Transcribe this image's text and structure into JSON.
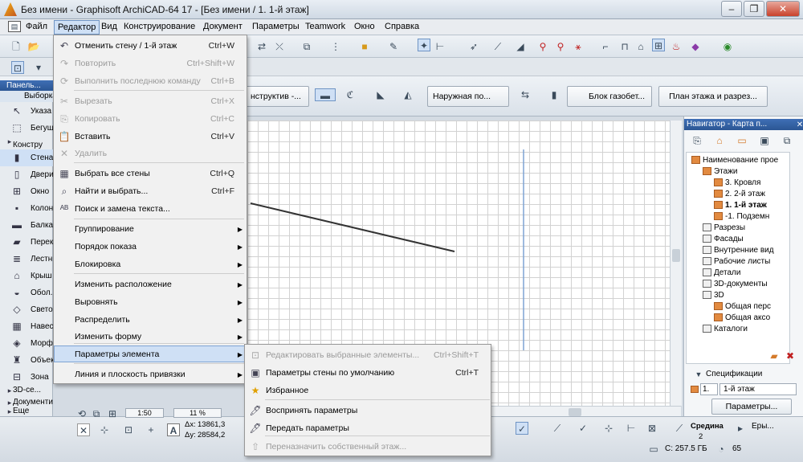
{
  "title": "Без имени - Graphisoft ArchiCAD-64 17 - [Без имени / 1. 1-й этаж]",
  "window_controls": {
    "minimize": "–",
    "maximize": "❐",
    "close": "✕"
  },
  "menu": [
    "Файл",
    "Редактор",
    "Вид",
    "Конструирование",
    "Документ",
    "Параметры",
    "Teamwork",
    "Окно",
    "Справка"
  ],
  "toolbar2": {
    "construct_label": "нструктив -...",
    "surface_label": "Наружная по...",
    "material_label": "Блок газобет...",
    "view_button": "План этажа и разрез..."
  },
  "left_panel": {
    "header": "Панель...",
    "select_tab": "Выборка",
    "items": [
      {
        "label": "Указа",
        "icon": "arrow-icon"
      },
      {
        "label": "Бегущ",
        "icon": "marquee-icon"
      },
      {
        "label": "Констру",
        "icon": "group-icon"
      },
      {
        "label": "Стена",
        "icon": "wall-icon"
      },
      {
        "label": "Двери",
        "icon": "door-icon"
      },
      {
        "label": "Окно",
        "icon": "window-icon"
      },
      {
        "label": "Колон",
        "icon": "column-icon"
      },
      {
        "label": "Балка",
        "icon": "beam-icon"
      },
      {
        "label": "Перек",
        "icon": "slab-icon"
      },
      {
        "label": "Лестн",
        "icon": "stair-icon"
      },
      {
        "label": "Крыш",
        "icon": "roof-icon"
      },
      {
        "label": "Обол.",
        "icon": "shell-icon"
      },
      {
        "label": "Свето",
        "icon": "skylight-icon"
      },
      {
        "label": "Навес",
        "icon": "curtain-wall-icon"
      },
      {
        "label": "Морф",
        "icon": "morph-icon"
      },
      {
        "label": "Объек",
        "icon": "object-icon"
      },
      {
        "label": "Зона",
        "icon": "zone-icon"
      },
      {
        "label": "3D-се...",
        "icon": "3d-mesh-icon"
      },
      {
        "label": "Документи",
        "icon": "group-icon"
      },
      {
        "label": "Еще",
        "icon": "group-icon"
      }
    ]
  },
  "edit_menu": [
    {
      "label": "Отменить стену / 1-й этаж",
      "shortcut": "Ctrl+W",
      "icon": "undo-icon",
      "disabled": false
    },
    {
      "label": "Повторить",
      "shortcut": "Ctrl+Shift+W",
      "icon": "redo-icon",
      "disabled": true
    },
    {
      "label": "Выполнить последнюю команду",
      "shortcut": "Ctrl+B",
      "icon": "repeat-icon",
      "disabled": true
    },
    {
      "label": "Вырезать",
      "shortcut": "Ctrl+X",
      "icon": "cut-icon",
      "disabled": true
    },
    {
      "label": "Копировать",
      "shortcut": "Ctrl+C",
      "icon": "copy-icon",
      "disabled": true
    },
    {
      "label": "Вставить",
      "shortcut": "Ctrl+V",
      "icon": "paste-icon",
      "disabled": false
    },
    {
      "label": "Удалить",
      "shortcut": "",
      "icon": "delete-icon",
      "disabled": true
    },
    {
      "label": "Выбрать все стены",
      "shortcut": "Ctrl+Q",
      "icon": "select-all-icon",
      "disabled": false
    },
    {
      "label": "Найти и выбрать...",
      "shortcut": "Ctrl+F",
      "icon": "find-select-icon",
      "disabled": false
    },
    {
      "label": "Поиск и замена текста...",
      "shortcut": "",
      "icon": "find-replace-icon",
      "disabled": false
    },
    {
      "label": "Группирование",
      "shortcut": "",
      "icon": "",
      "disabled": false
    },
    {
      "label": "Порядок показа",
      "shortcut": "",
      "icon": "",
      "disabled": false
    },
    {
      "label": "Блокировка",
      "shortcut": "",
      "icon": "",
      "disabled": false
    },
    {
      "label": "Изменить расположение",
      "shortcut": "",
      "icon": "",
      "disabled": false
    },
    {
      "label": "Выровнять",
      "shortcut": "",
      "icon": "",
      "disabled": false
    },
    {
      "label": "Распределить",
      "shortcut": "",
      "icon": "",
      "disabled": false
    },
    {
      "label": "Изменить форму",
      "shortcut": "",
      "icon": "",
      "disabled": false
    },
    {
      "label": "Параметры элемента",
      "shortcut": "",
      "icon": "",
      "disabled": false
    },
    {
      "label": "Линия и плоскость привязки",
      "shortcut": "",
      "icon": "",
      "disabled": false
    }
  ],
  "element_submenu": [
    {
      "label": "Редактировать выбранные элементы...",
      "shortcut": "Ctrl+Shift+T",
      "icon": "edit-selection-icon",
      "disabled": true
    },
    {
      "label": "Параметры стены по умолчанию",
      "shortcut": "Ctrl+T",
      "icon": "wall-settings-icon",
      "disabled": false
    },
    {
      "label": "Избранное",
      "shortcut": "",
      "icon": "star-icon",
      "disabled": false
    },
    {
      "label": "Воспринять параметры",
      "shortcut": "",
      "icon": "pick-up-icon",
      "disabled": false
    },
    {
      "label": "Передать параметры",
      "shortcut": "",
      "icon": "inject-icon",
      "disabled": false
    },
    {
      "label": "Переназначить собственный этаж...",
      "shortcut": "",
      "icon": "story-icon",
      "disabled": true
    }
  ],
  "navigator": {
    "header": "Навигатор - Карта п...",
    "tree": [
      {
        "label": "Наименование прое",
        "level": 0
      },
      {
        "label": "Этажи",
        "level": 1
      },
      {
        "label": "3. Кровля",
        "level": 2
      },
      {
        "label": "2. 2-й этаж",
        "level": 2
      },
      {
        "label": "1. 1-й этаж",
        "level": 2,
        "current": true
      },
      {
        "label": "-1. Подземн",
        "level": 2
      },
      {
        "label": "Разрезы",
        "level": 1
      },
      {
        "label": "Фасады",
        "level": 1
      },
      {
        "label": "Внутренние вид",
        "level": 1
      },
      {
        "label": "Рабочие листы",
        "level": 1
      },
      {
        "label": "Детали",
        "level": 1
      },
      {
        "label": "3D-документы",
        "level": 1
      },
      {
        "label": "3D",
        "level": 1
      },
      {
        "label": "Общая перс",
        "level": 2
      },
      {
        "label": "Общая аксо",
        "level": 2
      },
      {
        "label": "Каталоги",
        "level": 1
      }
    ],
    "spec_label": "Спецификации",
    "story_prefix": "1.",
    "story_value": "1-й этаж",
    "params_button": "Параметры..."
  },
  "status": {
    "scale": "1:50",
    "zoom": "11 %",
    "dx_label": "Δx:",
    "dx_value": "13861,3",
    "dy_label": "Δy:",
    "dy_value": "28584,2",
    "disk": "C: 257.5 ГБ",
    "memory": "65",
    "penset_label": "Средина",
    "penset_value": "2",
    "more": "Еры..."
  },
  "colors": {
    "accent": "#2b5694",
    "highlight": "#cfe0f5",
    "wall_line": "#333333"
  }
}
